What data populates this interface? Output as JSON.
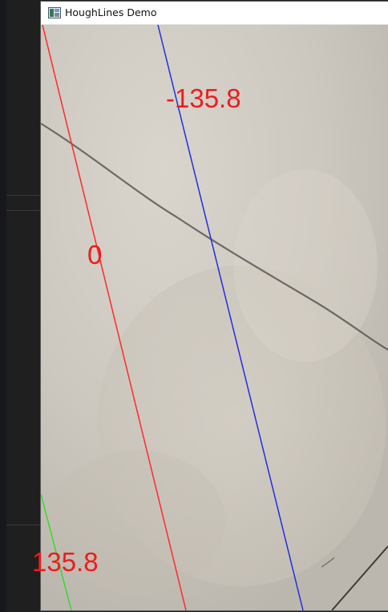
{
  "window": {
    "title": "HoughLines Demo",
    "app_icon": "image-window-icon"
  },
  "canvas": {
    "content": "floor-tile-photo",
    "detected_lines": [
      {
        "label": "0",
        "color": "#ff2a2a"
      },
      {
        "label": "-135.8",
        "color": "#1f2fe0"
      },
      {
        "label": "135.8",
        "color": "#36d92f"
      }
    ]
  },
  "colors": {
    "label_red": "#ee1c1c",
    "tile_base": "#cfcac1",
    "crack": "#4a4845"
  }
}
